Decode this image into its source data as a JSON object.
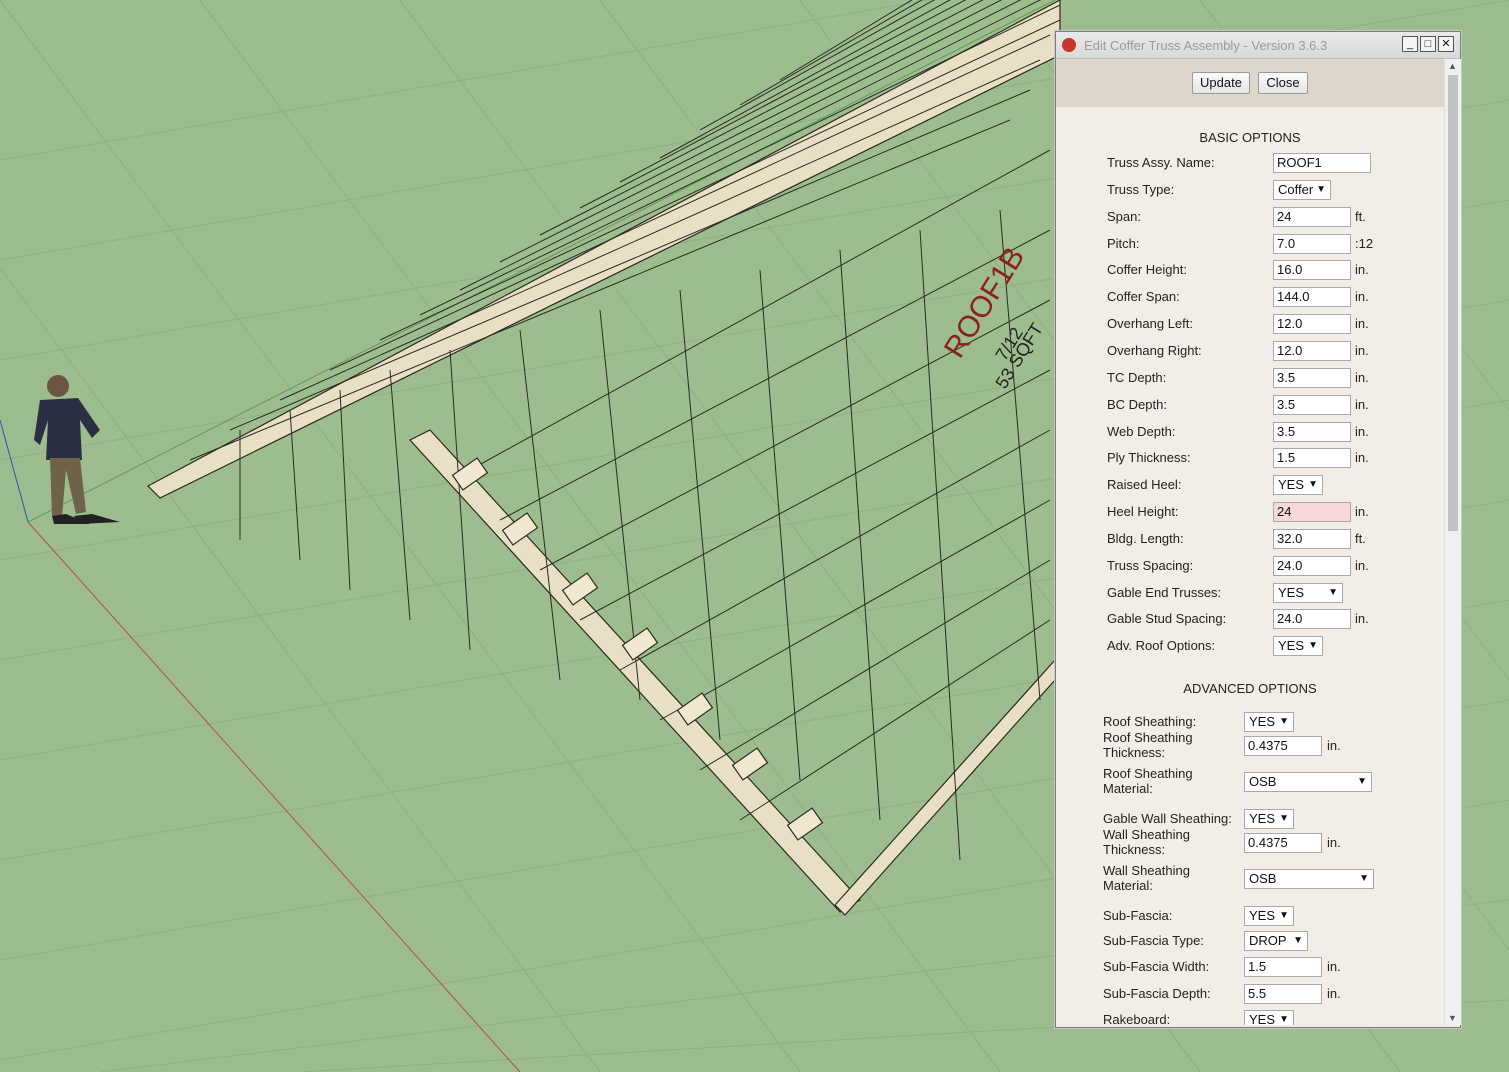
{
  "dialog": {
    "title": "Edit Coffer Truss Assembly - Version 3.6.3",
    "window_buttons": {
      "minimize": "_",
      "maximize": "□",
      "close": "✕"
    },
    "update_label": "Update",
    "close_label": "Close"
  },
  "scene_labels": {
    "roof_tag": "ROOF1B",
    "pitch_tag": "7/12",
    "count_tag": "53 SQFT"
  },
  "basic": {
    "heading": "BASIC OPTIONS",
    "fields": [
      {
        "label": "Truss Assy. Name:",
        "value": "ROOF1",
        "kind": "input",
        "unit": ""
      },
      {
        "label": "Truss Type:",
        "value": "Coffer",
        "kind": "select",
        "unit": ""
      },
      {
        "label": "Span:",
        "value": "24",
        "kind": "input",
        "unit": "ft."
      },
      {
        "label": "Pitch:",
        "value": "7.0",
        "kind": "input",
        "unit": ":12"
      },
      {
        "label": "Coffer Height:",
        "value": "16.0",
        "kind": "input",
        "unit": "in."
      },
      {
        "label": "Coffer Span:",
        "value": "144.0",
        "kind": "input",
        "unit": "in."
      },
      {
        "label": "Overhang Left:",
        "value": "12.0",
        "kind": "input",
        "unit": "in."
      },
      {
        "label": "Overhang Right:",
        "value": "12.0",
        "kind": "input",
        "unit": "in."
      },
      {
        "label": "TC Depth:",
        "value": "3.5",
        "kind": "input",
        "unit": "in."
      },
      {
        "label": "BC Depth:",
        "value": "3.5",
        "kind": "input",
        "unit": "in."
      },
      {
        "label": "Web Depth:",
        "value": "3.5",
        "kind": "input",
        "unit": "in."
      },
      {
        "label": "Ply Thickness:",
        "value": "1.5",
        "kind": "input",
        "unit": "in."
      },
      {
        "label": "Raised Heel:",
        "value": "YES",
        "kind": "select",
        "unit": ""
      },
      {
        "label": "Heel Height:",
        "value": "24",
        "kind": "input-error",
        "unit": "in."
      },
      {
        "label": "Bldg. Length:",
        "value": "32.0",
        "kind": "input",
        "unit": "ft."
      },
      {
        "label": "Truss Spacing:",
        "value": "24.0",
        "kind": "input",
        "unit": "in."
      },
      {
        "label": "Gable End Trusses:",
        "value": "YES",
        "kind": "select",
        "unit": ""
      },
      {
        "label": "Gable Stud Spacing:",
        "value": "24.0",
        "kind": "input",
        "unit": "in."
      },
      {
        "label": "Adv. Roof Options:",
        "value": "YES",
        "kind": "select",
        "unit": ""
      }
    ]
  },
  "advanced": {
    "heading": "ADVANCED OPTIONS",
    "fields": [
      {
        "label": "Roof Sheathing:",
        "value": "YES",
        "kind": "select",
        "unit": ""
      },
      {
        "label": "Roof Sheathing Thickness:",
        "value": "0.4375",
        "kind": "input",
        "unit": "in."
      },
      {
        "label": "Roof Sheathing Material:",
        "value": "OSB",
        "kind": "select",
        "unit": ""
      },
      {
        "label": "Gable Wall Sheathing:",
        "value": "YES",
        "kind": "select",
        "unit": ""
      },
      {
        "label": "Wall Sheathing Thickness:",
        "value": "0.4375",
        "kind": "input",
        "unit": "in."
      },
      {
        "label": "Wall Sheathing Material:",
        "value": "OSB",
        "kind": "select",
        "unit": ""
      },
      {
        "label": "Sub-Fascia:",
        "value": "YES",
        "kind": "select",
        "unit": ""
      },
      {
        "label": "Sub-Fascia Type:",
        "value": "DROP",
        "kind": "select",
        "unit": ""
      },
      {
        "label": "Sub-Fascia Width:",
        "value": "1.5",
        "kind": "input",
        "unit": "in."
      },
      {
        "label": "Sub-Fascia Depth:",
        "value": "5.5",
        "kind": "input",
        "unit": "in."
      },
      {
        "label": "Rakeboard:",
        "value": "YES",
        "kind": "select",
        "unit": ""
      }
    ]
  }
}
